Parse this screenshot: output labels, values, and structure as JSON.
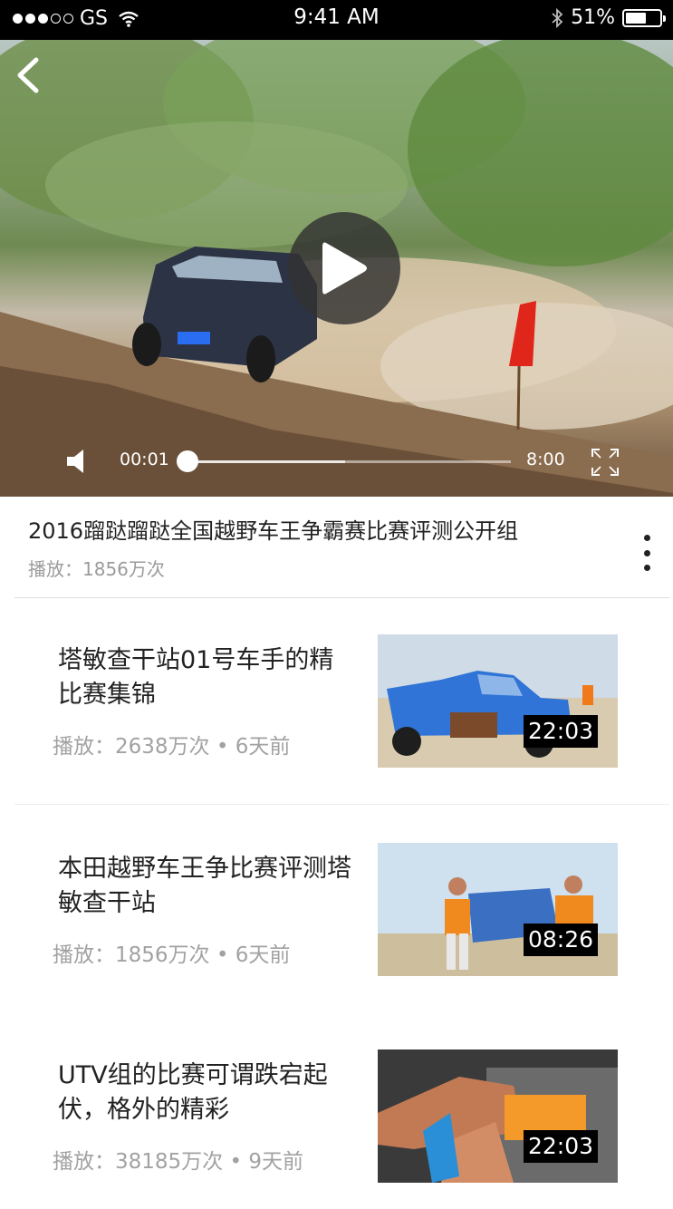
{
  "status_bar": {
    "carrier": "GS",
    "time": "9:41 AM",
    "battery": "51%"
  },
  "player": {
    "current_time": "00:01",
    "total_time": "8:00",
    "progress": 0.002,
    "buffered": 0.49
  },
  "video": {
    "title": "2016蹓跶蹓跶全国越野车王争霸赛比赛评测公开组",
    "plays": "播放：1856万次"
  },
  "related": [
    {
      "title": "塔敏查干站01号车手的精比赛集锦",
      "meta": "播放：2638万次 • 6天前",
      "duration": "22:03"
    },
    {
      "title": "本田越野车王争比赛评测塔敏查干站",
      "meta": "播放：1856万次 • 6天前",
      "duration": "08:26"
    },
    {
      "title": "UTV组的比赛可谓跌宕起伏，格外的精彩",
      "meta": "播放：38185万次 • 9天前",
      "duration": "22:03"
    }
  ],
  "icons": {
    "back": "chevron-left-icon",
    "play": "play-icon",
    "volume": "speaker-icon",
    "fullscreen": "fullscreen-icon",
    "more": "more-vertical-icon"
  }
}
